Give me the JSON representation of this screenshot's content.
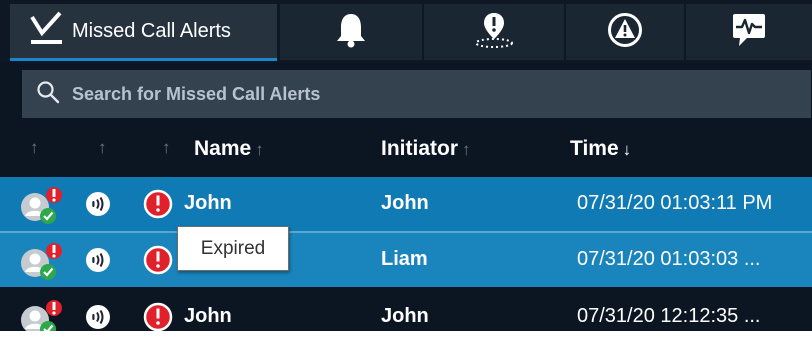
{
  "tabs": [
    {
      "label": "Missed Call Alerts",
      "icon": "check-underline-icon",
      "active": true
    },
    {
      "icon": "bell-icon"
    },
    {
      "icon": "location-pin-alert-icon"
    },
    {
      "icon": "warning-circle-icon"
    },
    {
      "icon": "heartbeat-chat-icon"
    }
  ],
  "search": {
    "placeholder": "Search for Missed Call Alerts",
    "value": ""
  },
  "columns": {
    "name": "Name",
    "initiator": "Initiator",
    "time": "Time"
  },
  "sort": {
    "name": "ascending-inactive",
    "initiator": "ascending-inactive",
    "time": "descending-active"
  },
  "rows": [
    {
      "name": "John",
      "initiator": "John",
      "time": "07/31/20 01:03:11 PM",
      "state": "selected"
    },
    {
      "name": "",
      "initiator": "Liam",
      "time": "07/31/20 01:03:03 ...",
      "state": "hovered"
    },
    {
      "name": "John",
      "initiator": "John",
      "time": "07/31/20 12:12:35 ...",
      "state": "normal"
    }
  ],
  "tooltip": {
    "text": "Expired"
  },
  "colors": {
    "background": "#0c1623",
    "selected_row": "#0f7ab4",
    "hover_row": "#1a85bd",
    "accent": "#1a86c9",
    "alert_red": "#e0202a",
    "ok_green": "#2da84a"
  }
}
